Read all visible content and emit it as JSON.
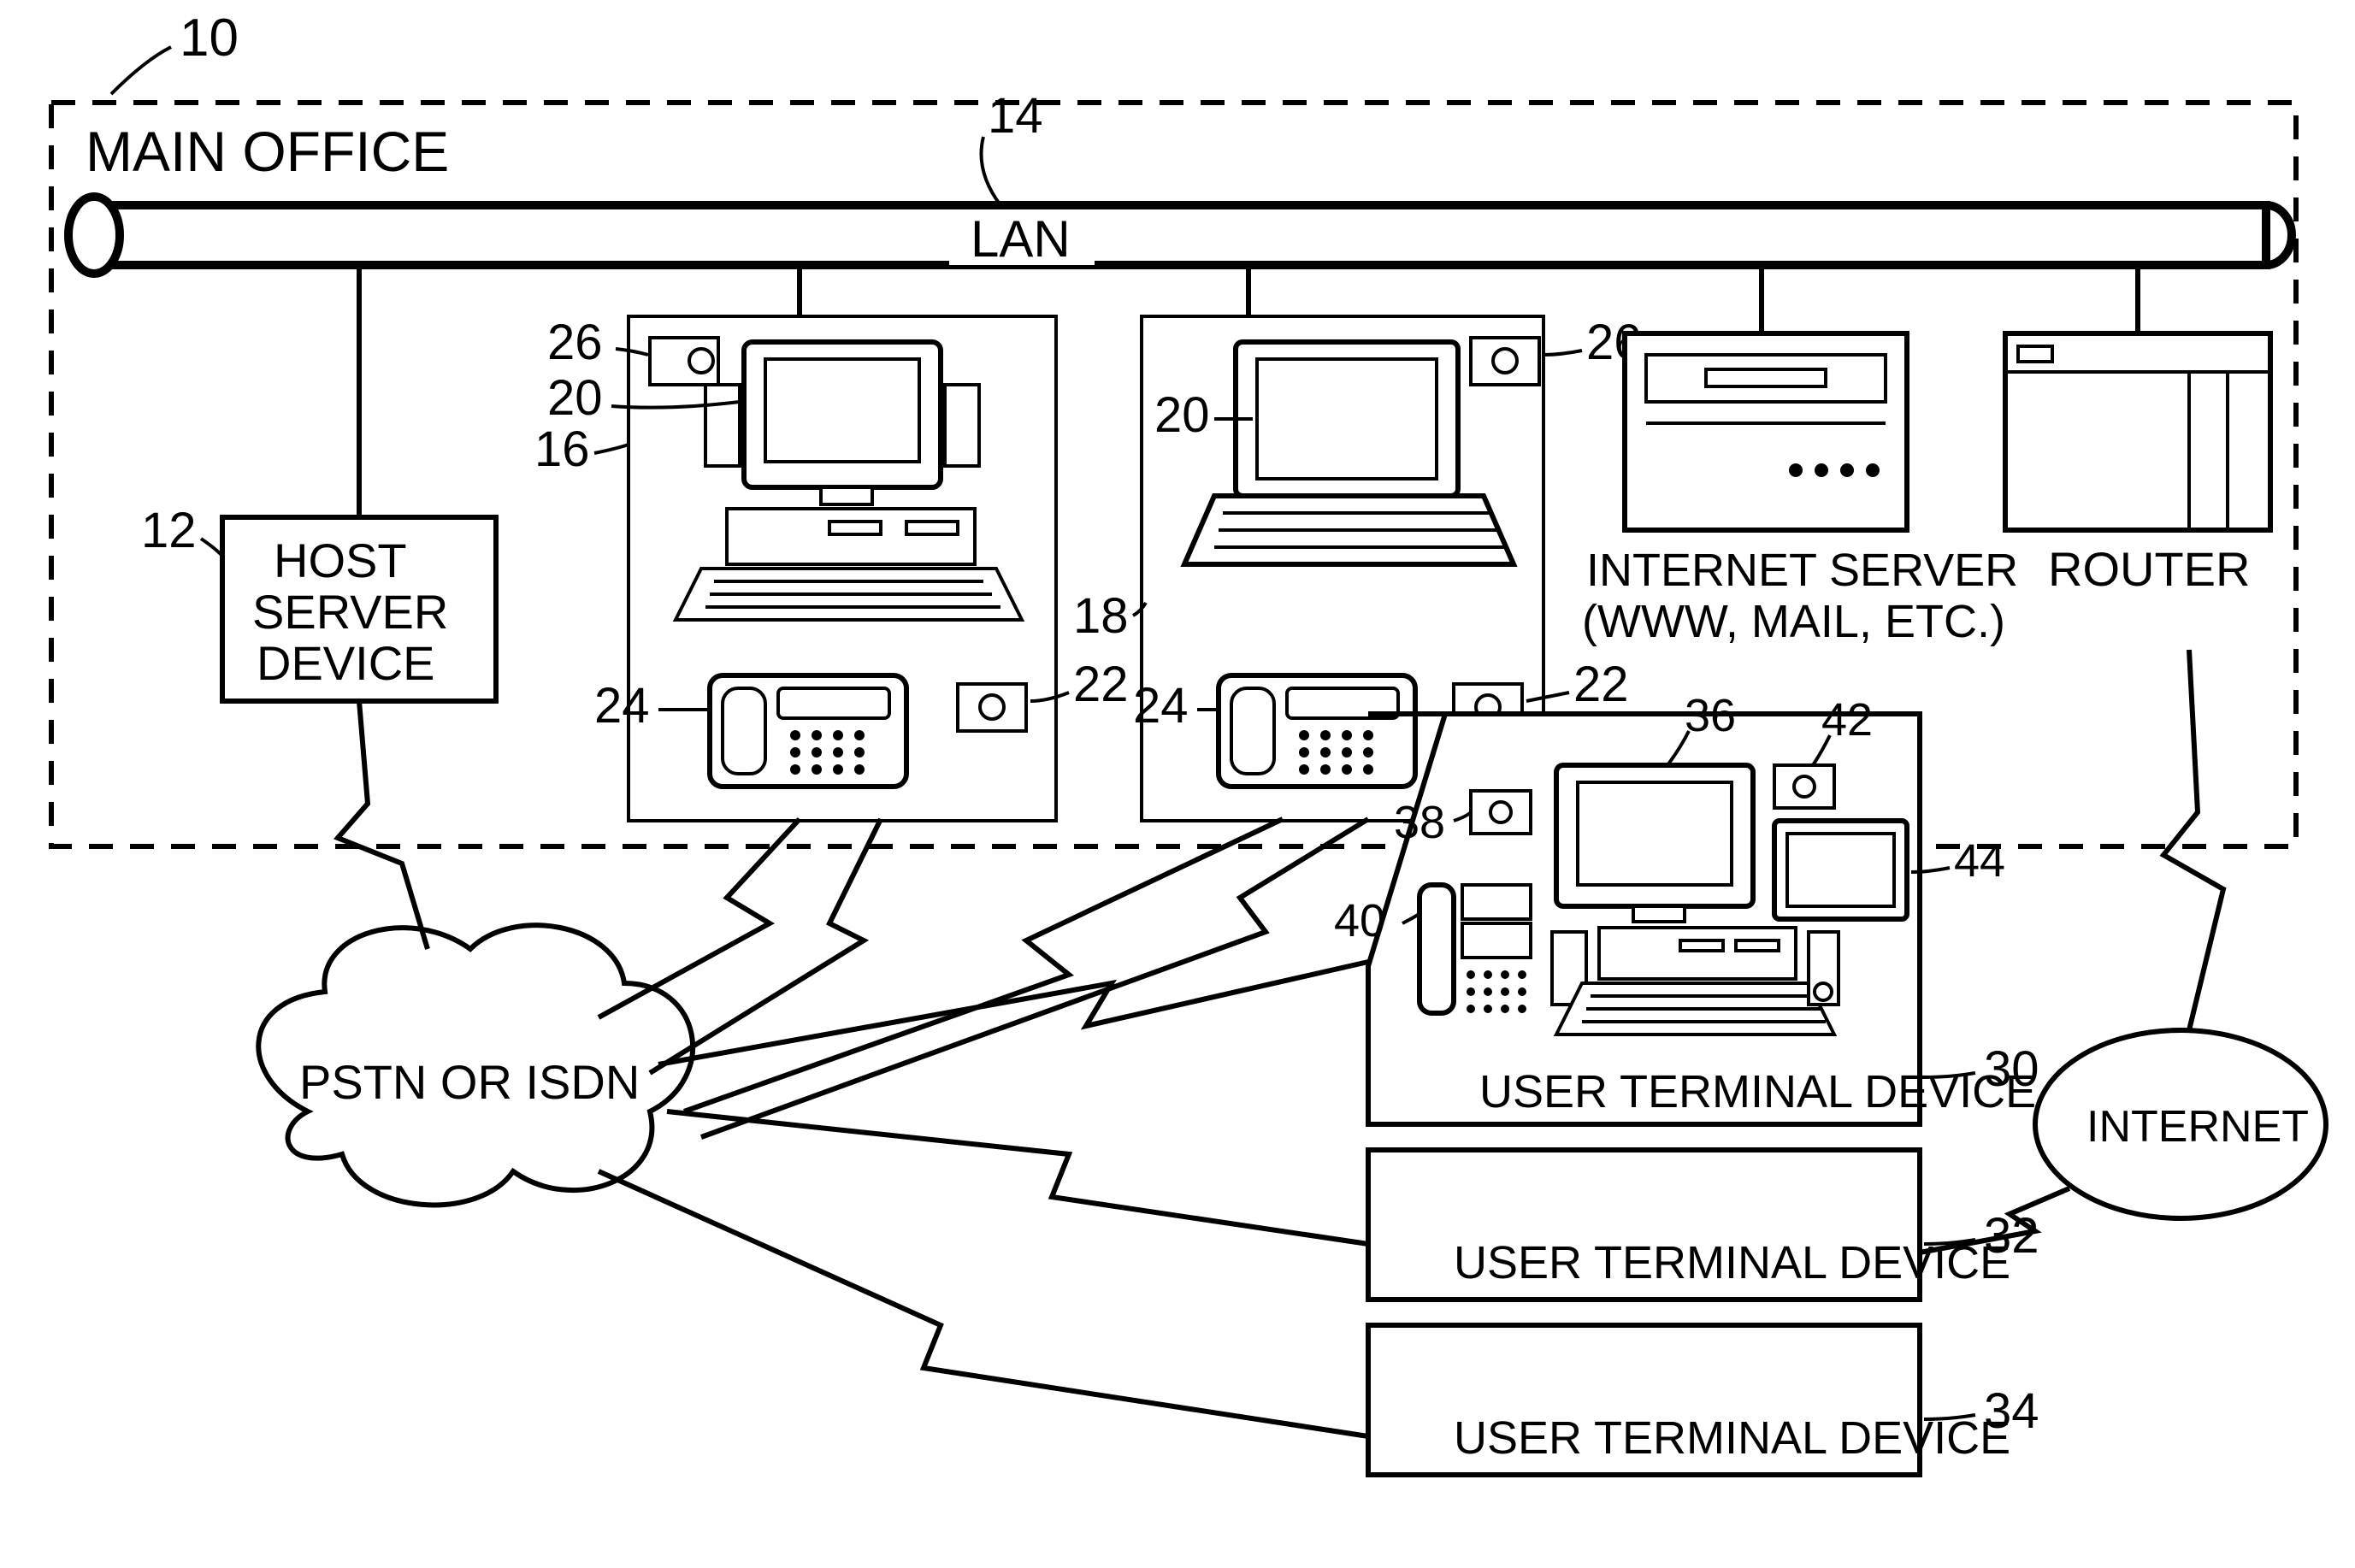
{
  "labels": {
    "main_office": "MAIN OFFICE",
    "lan": "LAN",
    "host_server": "HOST\nSERVER\nDEVICE",
    "internet_server": "INTERNET SERVER\n(WWW, MAIL, ETC.)",
    "router": "ROUTER",
    "pstn": "PSTN OR ISDN",
    "internet": "INTERNET",
    "user_terminal_device": "USER TERMINAL DEVICE"
  },
  "refs": {
    "n10": "10",
    "n12": "12",
    "n14": "14",
    "n16": "16",
    "n18": "18",
    "n20_left": "20",
    "n20_right": "20",
    "n22_left": "22",
    "n22_right": "22",
    "n24_left": "24",
    "n24_right": "24",
    "n26_left": "26",
    "n26_right": "26",
    "n30": "30",
    "n32": "32",
    "n34": "34",
    "n36": "36",
    "n38": "38",
    "n40": "40",
    "n42": "42",
    "n44": "44"
  }
}
